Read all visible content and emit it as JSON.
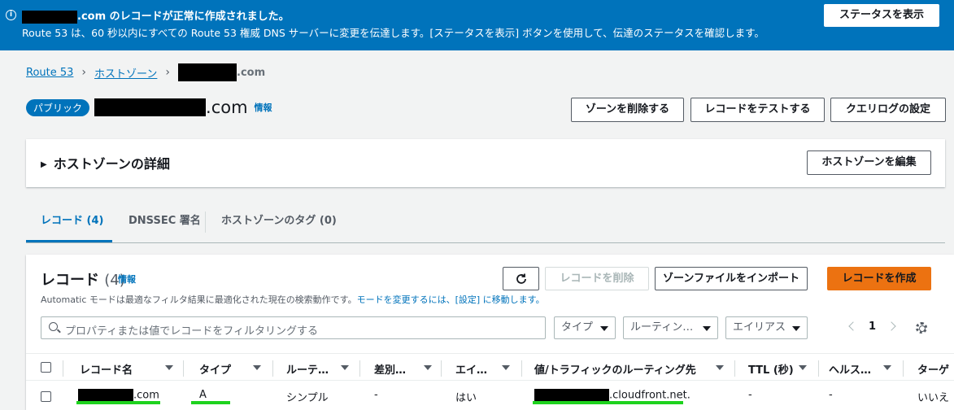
{
  "flash": {
    "icon": "info-icon",
    "title_suffix": ".com のレコードが正常に作成されました。",
    "message": "Route 53 は、60 秒以内にすべての Route 53 権威 DNS サーバーに変更を伝達します。[ステータスを表示] ボタンを使用して、伝達のステータスを確認します。",
    "button": "ステータスを表示",
    "background": "#0073bb"
  },
  "breadcrumb": {
    "items": [
      "Route 53",
      "ホストゾーン"
    ],
    "current_suffix": ".com"
  },
  "header": {
    "badge": "パブリック",
    "zone_suffix": ".com",
    "info": "情報",
    "buttons": [
      "ゾーンを削除する",
      "レコードをテストする",
      "クエリログの設定"
    ]
  },
  "details": {
    "title": "ホストゾーンの詳細",
    "edit_button": "ホストゾーンを編集"
  },
  "tabs": [
    {
      "label": "レコード (4)",
      "active": true
    },
    {
      "label": "DNSSEC 署名",
      "active": false
    },
    {
      "label": "ホストゾーンのタグ (0)",
      "active": false
    }
  ],
  "records": {
    "title": "レコード",
    "count": "(4)",
    "info": "情報",
    "description": "Automatic モードは最適なフィルタ結果に最適化された現在の検索動作です。",
    "description_link": "モードを変更するには、[設定] に移動します。",
    "buttons": {
      "refresh": "refresh-icon",
      "delete": "レコードを削除",
      "import": "ゾーンファイルをインポート",
      "create": "レコードを作成"
    },
    "search_placeholder": "プロパティまたは値でレコードをフィルタリングする",
    "filters": [
      "タイプ",
      "ルーティン…",
      "エイリアス"
    ],
    "page": "1",
    "columns": [
      "レコード名",
      "タイプ",
      "ルーテ…",
      "差別…",
      "エイ…",
      "値/トラフィックのルーティング先",
      "TTL (秒)",
      "ヘルス…",
      "ターゲ"
    ],
    "rows": [
      {
        "name_suffix": ".com",
        "type": "A",
        "routing": "シンプル",
        "diff": "-",
        "alias": "はい",
        "value_suffix": ".cloudfront.net.",
        "ttl": "-",
        "health": "-",
        "target": "いいえ"
      }
    ]
  },
  "colors": {
    "accent": "#0073bb",
    "primary_button": "#ec7211",
    "highlight": "#1ed21e"
  }
}
